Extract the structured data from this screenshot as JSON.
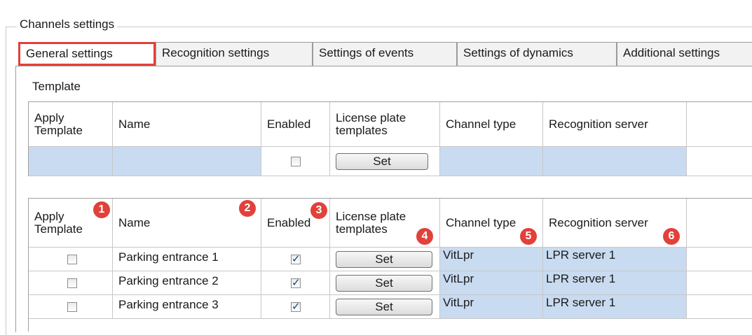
{
  "group": {
    "title": "Channels settings"
  },
  "tabs": [
    {
      "label": "General settings",
      "active": true
    },
    {
      "label": "Recognition settings"
    },
    {
      "label": "Settings of events"
    },
    {
      "label": "Settings of dynamics"
    },
    {
      "label": "Additional settings"
    }
  ],
  "template_section": {
    "label": "Template"
  },
  "columns": {
    "apply_template": "Apply Template",
    "name": "Name",
    "enabled": "Enabled",
    "license_plate_templates": "License plate templates",
    "channel_type": "Channel type",
    "recognition_server": "Recognition server"
  },
  "template_row": {
    "enabled": false,
    "button_label": "Set"
  },
  "channels": [
    {
      "apply": false,
      "name": "Parking entrance 1",
      "enabled": true,
      "button_label": "Set",
      "channel_type": "VitLpr",
      "server": "LPR server 1"
    },
    {
      "apply": false,
      "name": "Parking entrance 2",
      "enabled": true,
      "button_label": "Set",
      "channel_type": "VitLpr",
      "server": "LPR server 1"
    },
    {
      "apply": false,
      "name": "Parking entrance 3",
      "enabled": true,
      "button_label": "Set",
      "channel_type": "VitLpr",
      "server": "LPR server 1"
    }
  ],
  "badges": [
    "1",
    "2",
    "3",
    "4",
    "5",
    "6"
  ],
  "colors": {
    "highlight_border": "#e2403a",
    "cell_blue": "#c9dbf0",
    "badge": "#e2403a"
  }
}
